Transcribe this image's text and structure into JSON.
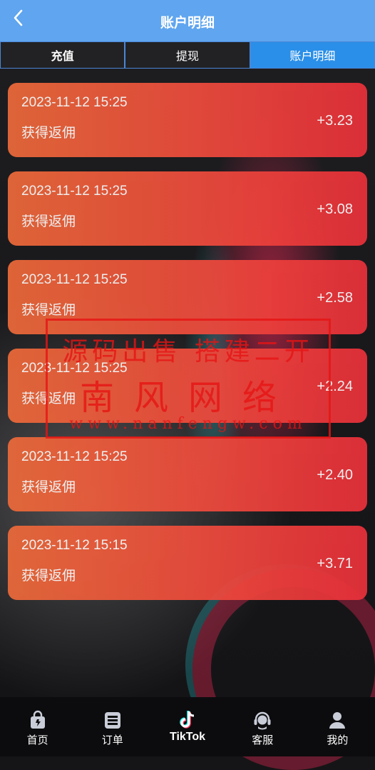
{
  "header": {
    "title": "账户明细",
    "back_icon": "chevron-left-icon"
  },
  "tabs": [
    {
      "label": "充值",
      "active": false
    },
    {
      "label": "提现",
      "active": false
    },
    {
      "label": "账户明细",
      "active": true
    }
  ],
  "records": [
    {
      "time": "2023-11-12 15:25",
      "desc": "获得返佣",
      "amount": "+3.23"
    },
    {
      "time": "2023-11-12 15:25",
      "desc": "获得返佣",
      "amount": "+3.08"
    },
    {
      "time": "2023-11-12 15:25",
      "desc": "获得返佣",
      "amount": "+2.58"
    },
    {
      "time": "2023-11-12 15:25",
      "desc": "获得返佣",
      "amount": "+2.24"
    },
    {
      "time": "2023-11-12 15:25",
      "desc": "获得返佣",
      "amount": "+2.40"
    },
    {
      "time": "2023-11-12 15:15",
      "desc": "获得返佣",
      "amount": "+3.71"
    }
  ],
  "watermark": {
    "line1": "源码出售 搭建二开",
    "line2": "南风网络",
    "line3": "www.nanfengw.com"
  },
  "nav": [
    {
      "label": "首页",
      "icon": "shopping-bag-icon"
    },
    {
      "label": "订单",
      "icon": "clipboard-list-icon"
    },
    {
      "label": "TikTok",
      "icon": "tiktok-logo-icon"
    },
    {
      "label": "客服",
      "icon": "headset-icon"
    },
    {
      "label": "我的",
      "icon": "user-icon"
    }
  ],
  "colors": {
    "header": "#5fa5ef",
    "tab_active": "#2a8fe8",
    "card_start": "#ec6a3a",
    "card_end": "#e9303a",
    "watermark": "#e61414"
  }
}
